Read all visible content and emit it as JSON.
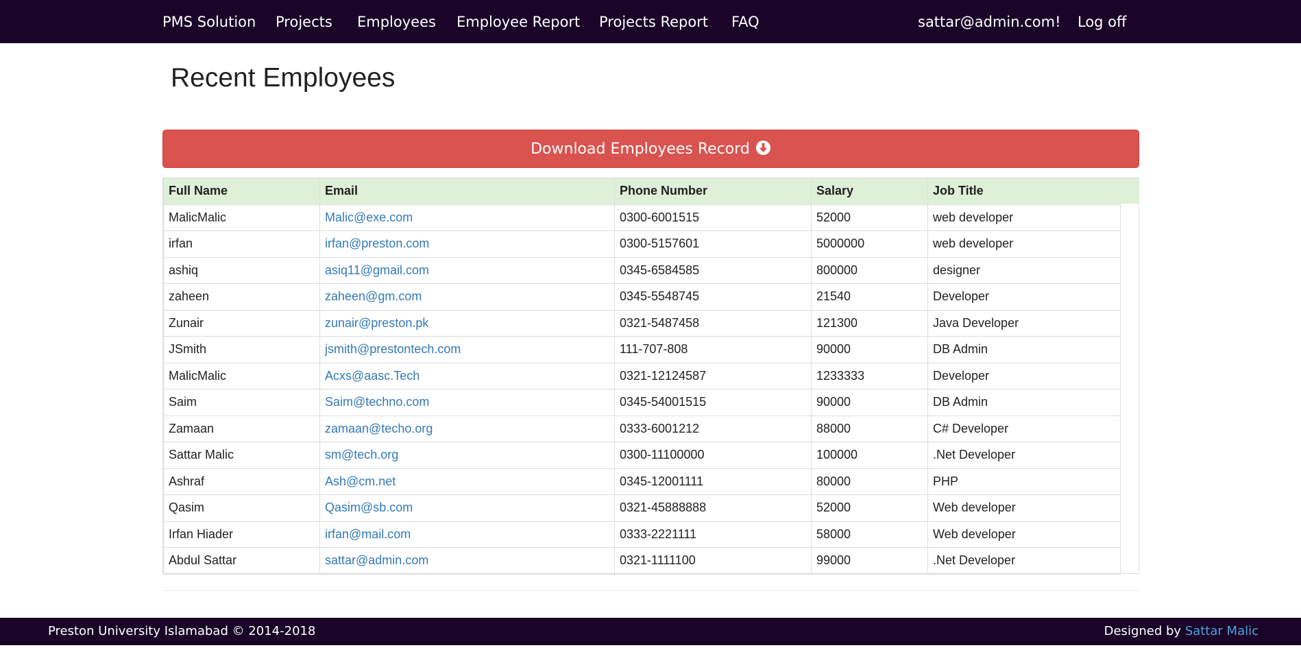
{
  "navbar": {
    "brand": "PMS Solution",
    "links": [
      "Projects",
      "Employees",
      "Employee Report",
      "Projects Report",
      "FAQ"
    ],
    "user": "sattar@admin.com!",
    "logoff": "Log off"
  },
  "page": {
    "title": "Recent Employees",
    "download_label": "Download Employees Record",
    "download_icon": "circle-arrow-down-icon",
    "download_color": "#d9534f"
  },
  "table": {
    "columns": [
      "Full Name",
      "Email",
      "Phone Number",
      "Salary",
      "Job Title"
    ],
    "rows": [
      [
        "MalicMalic",
        "Malic@exe.com",
        "0300-6001515",
        "52000",
        "web developer"
      ],
      [
        "irfan",
        "irfan@preston.com",
        "0300-5157601",
        "5000000",
        "web developer"
      ],
      [
        "ashiq",
        "asiq11@gmail.com",
        "0345-6584585",
        "800000",
        "designer"
      ],
      [
        "zaheen",
        "zaheen@gm.com",
        "0345-5548745",
        "21540",
        "Developer"
      ],
      [
        "Zunair",
        "zunair@preston.pk",
        "0321-5487458",
        "121300",
        "Java Developer"
      ],
      [
        "JSmith",
        "jsmith@prestontech.com",
        "111-707-808",
        "90000",
        "DB Admin"
      ],
      [
        "MalicMalic",
        "Acxs@aasc.Tech",
        "0321-12124587",
        "1233333",
        "Developer"
      ],
      [
        "Saim",
        "Saim@techno.com",
        "0345-54001515",
        "90000",
        "DB Admin"
      ],
      [
        "Zamaan",
        "zamaan@techo.org",
        "0333-6001212",
        "88000",
        "C# Developer"
      ],
      [
        "Sattar Malic",
        "sm@tech.org",
        "0300-11100000",
        "100000",
        ".Net Developer"
      ],
      [
        "Ashraf",
        "Ash@cm.net",
        "0345-12001111",
        "80000",
        "PHP"
      ],
      [
        "Qasim",
        "Qasim@sb.com",
        "0321-45888888",
        "52000",
        "Web developer"
      ],
      [
        "Irfan Hiader",
        "irfan@mail.com",
        "0333-2221111",
        "58000",
        "Web developer"
      ],
      [
        "Abdul Sattar",
        "sattar@admin.com",
        "0321-1111100",
        "99000",
        ".Net Developer"
      ]
    ],
    "header_color": "#dff0d8",
    "link_color": "#337ab7"
  },
  "footer": {
    "copyright": "Preston University Islamabad © 2014-2018",
    "designed_by": "Designed by",
    "designer": "Sattar Malic"
  },
  "colors": {
    "navbar_bg": "#1a0529"
  }
}
